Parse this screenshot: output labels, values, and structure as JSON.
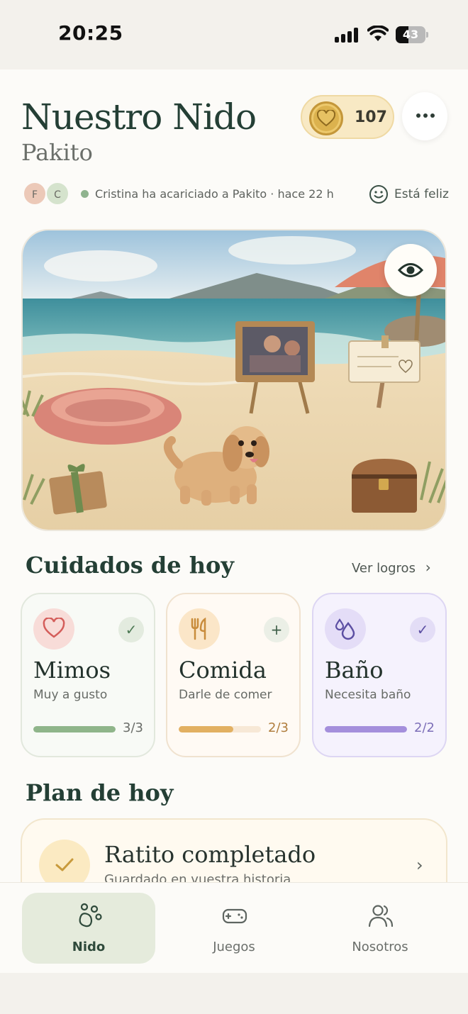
{
  "status_bar": {
    "time": "20:25",
    "battery": "43",
    "battery_level": 0.43
  },
  "header": {
    "title": "Nuestro Nido",
    "pet_name": "Pakito",
    "coins": "107",
    "menu_icon": "more-dots-icon"
  },
  "activity": {
    "avatars": [
      "F",
      "C"
    ],
    "text": "Cristina ha acariciado a Pakito · hace 22 h",
    "mood": "Está feliz"
  },
  "scene": {
    "view_icon": "eye-icon",
    "items": [
      "bed-icon",
      "puppy-icon",
      "photo-easel-icon",
      "note-sign-icon",
      "gift-icon",
      "treasure-chest-icon",
      "umbrella-icon"
    ]
  },
  "care": {
    "title": "Cuidados de hoy",
    "link": "Ver logros",
    "cards": [
      {
        "name": "Mimos",
        "desc": "Muy a gusto",
        "count": "3/3",
        "progress": 1.0,
        "icon": "heart-icon",
        "badge": "check-icon",
        "accent": "#8fb58a"
      },
      {
        "name": "Comida",
        "desc": "Darle de comer",
        "count": "2/3",
        "progress": 0.6667,
        "icon": "fork-knife-icon",
        "badge": "plus-icon",
        "accent": "#e2b062"
      },
      {
        "name": "Baño",
        "desc": "Necesita baño",
        "count": "2/2",
        "progress": 1.0,
        "icon": "water-drops-icon",
        "badge": "check-icon",
        "accent": "#a48fdc"
      }
    ]
  },
  "plan": {
    "title": "Plan de hoy",
    "item_title": "Ratito completado",
    "item_sub": "Guardado en vuestra historia"
  },
  "tabs": [
    {
      "label": "Nido",
      "icon": "paw-icon",
      "active": true
    },
    {
      "label": "Juegos",
      "icon": "gamepad-icon",
      "active": false
    },
    {
      "label": "Nosotros",
      "icon": "people-icon",
      "active": false
    }
  ]
}
